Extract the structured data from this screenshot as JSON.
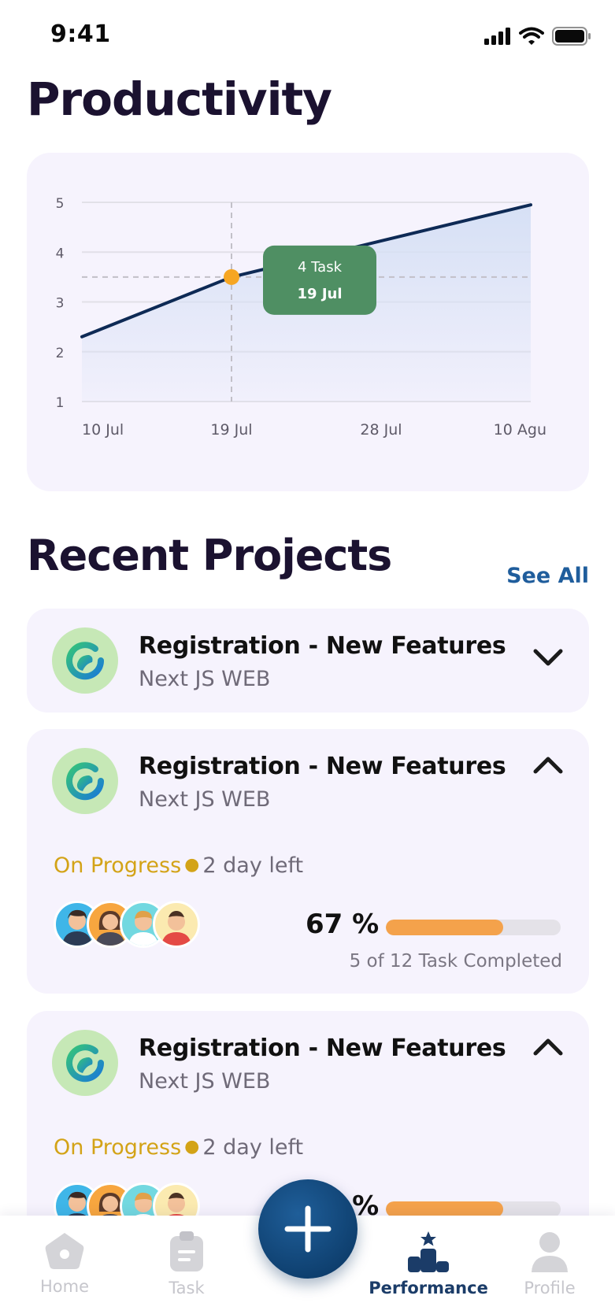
{
  "status_bar": {
    "time": "9:41"
  },
  "headers": {
    "productivity": "Productivity",
    "recent_projects": "Recent Projects",
    "see_all": "See All"
  },
  "chart_data": {
    "type": "area",
    "title": "",
    "xlabel": "",
    "ylabel": "",
    "y_ticks": [
      "5",
      "4",
      "3",
      "2",
      "1"
    ],
    "x_ticks": [
      "10 Jul",
      "19 Jul",
      "28 Jul",
      "10 Agu"
    ],
    "ylim": [
      1,
      5
    ],
    "grid": true,
    "series": [
      {
        "x": [
          "10 Jul",
          "19 Jul",
          "10 Agu"
        ],
        "values": [
          2.3,
          3.5,
          4.95
        ]
      }
    ],
    "highlight": {
      "x": "19 Jul",
      "y": 3.5,
      "tooltip_value": "4 Task",
      "tooltip_date": "19 Jul"
    },
    "colors": {
      "line": "#0e2a55",
      "area": "#d6e0f5",
      "point": "#f6a623",
      "tooltip": "#4f8f63"
    }
  },
  "projects": [
    {
      "name": "Registration - New Features",
      "subtitle": "Next JS WEB",
      "expanded": false
    },
    {
      "name": "Registration - New Features",
      "subtitle": "Next JS WEB",
      "expanded": true,
      "status": "On Progress",
      "time_left": "2 day left",
      "percent_label": "67 %",
      "progress": 0.67,
      "task_text": "5 of 12 Task Completed"
    },
    {
      "name": "Registration - New Features",
      "subtitle": "Next JS WEB",
      "expanded": true,
      "status": "On Progress",
      "time_left": "2 day left",
      "percent_label": "67 %",
      "progress": 0.67
    }
  ],
  "nav": {
    "items": [
      {
        "label": "Home",
        "icon": "home-icon"
      },
      {
        "label": "Task",
        "icon": "task-clipboard-icon"
      },
      {
        "label": "Performance",
        "icon": "podium-star-icon",
        "active": true
      },
      {
        "label": "Profile",
        "icon": "user-icon"
      }
    ],
    "fab_icon": "plus-icon"
  },
  "theme": {
    "card_bg": "#f6f3fd",
    "accent": "#1f5d9c",
    "status_color": "#d3a317",
    "progress_color": "#f4a24b"
  }
}
